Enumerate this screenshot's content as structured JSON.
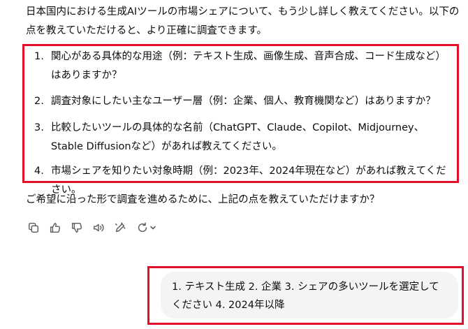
{
  "assistant": {
    "intro": "日本国内における生成AIツールの市場シェアについて、もう少し詳しく教えてください。以下の点を教えていただけると、より正確に調査できます。",
    "questions": [
      {
        "num": "1.",
        "text": "関心がある具体的な用途（例：テキスト生成、画像生成、音声合成、コード生成など）はありますか？"
      },
      {
        "num": "2.",
        "text": "調査対象にしたい主なユーザー層（例：企業、個人、教育機関など）はありますか？"
      },
      {
        "num": "3.",
        "text": "比較したいツールの具体的な名前（ChatGPT、Claude、Copilot、Midjourney、Stable Diffusionなど）があれば教えてください。"
      },
      {
        "num": "4.",
        "text": "市場シェアを知りたい対象時期（例：2023年、2024年現在など）があれば教えてください。"
      }
    ],
    "closing": "ご希望に沿った形で調査を進めるために、上記の点を教えていただけますか？"
  },
  "actions": [
    "copy-icon",
    "thumbs-up-icon",
    "thumbs-down-icon",
    "read-aloud-icon",
    "edit-canvas-icon",
    "regenerate-icon"
  ],
  "user_message": {
    "text": "1. テキスト生成 2. 企業 3. シェアの多いツールを選定してください 4. 2024年以降"
  },
  "colors": {
    "highlight_border": "#e0102a",
    "bubble_bg": "#f4f4f4",
    "icon": "#5d5d5d"
  }
}
